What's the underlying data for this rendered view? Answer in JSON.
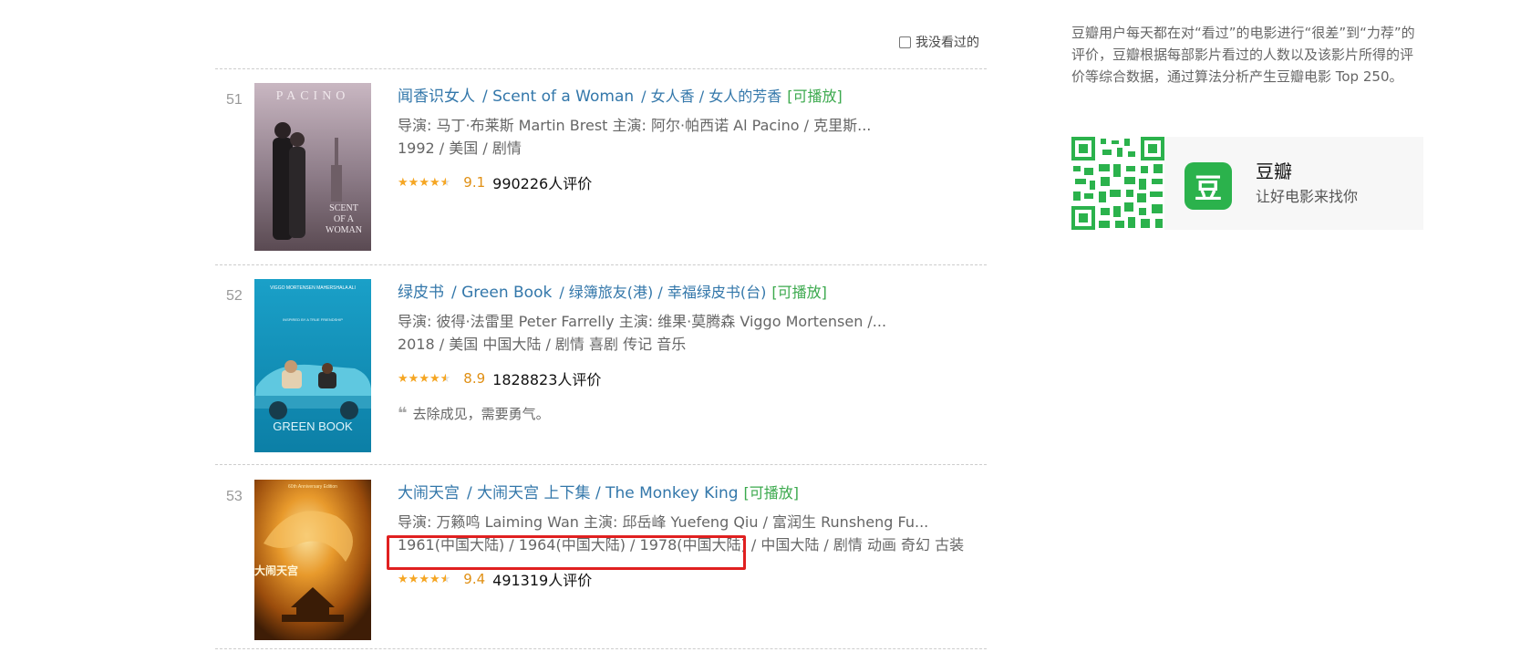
{
  "filter": {
    "label": "我没看过的",
    "checked": false
  },
  "movies": [
    {
      "rank": "51",
      "title": "闻香识女人",
      "other_title": "/ Scent of a Woman",
      "alt_titles": "/ 女人香 / 女人的芳香",
      "playable": "[可播放]",
      "credits": "导演: 马丁·布莱斯 Martin Brest   主演: 阿尔·帕西诺 Al Pacino / 克里斯...",
      "info": "1992 / 美国 / 剧情",
      "stars": 4.5,
      "rating": "9.1",
      "rating_count": "990226人评价",
      "quote": "",
      "poster": {
        "name": "scent-of-a-woman-poster",
        "text_top": "PACINO",
        "text_bottom": "SCENT OF A WOMAN"
      }
    },
    {
      "rank": "52",
      "title": "绿皮书",
      "other_title": "/ Green Book",
      "alt_titles": "/ 绿簿旅友(港) / 幸福绿皮书(台)",
      "playable": "[可播放]",
      "credits": "导演: 彼得·法雷里 Peter Farrelly   主演: 维果·莫腾森 Viggo Mortensen /...",
      "info": "2018 / 美国 中国大陆 / 剧情 喜剧 传记 音乐",
      "stars": 4.5,
      "rating": "8.9",
      "rating_count": "1828823人评价",
      "quote": "去除成见，需要勇气。",
      "poster": {
        "name": "green-book-poster",
        "text_top": "VIGGO MORTENSEN   MAHERSHALA ALI",
        "text_bottom": "GREEN BOOK"
      }
    },
    {
      "rank": "53",
      "title": "大闹天宫",
      "other_title": "/ 大闹天宫 上下集 / The Monkey King",
      "alt_titles": "",
      "playable": "[可播放]",
      "credits": "导演: 万籁鸣 Laiming Wan   主演: 邱岳峰 Yuefeng Qiu / 富润生 Runsheng Fu...",
      "info_highlight": "1961(中国大陆) / 1964(中国大陆) / 1978(中国大陆)",
      "info_rest": " / 中国大陆 / 剧情 动画 奇幻 古装",
      "stars": 4.5,
      "rating": "9.4",
      "rating_count": "491319人评价",
      "quote": "",
      "poster": {
        "name": "monkey-king-poster",
        "text_top": "60th Anniversary Edition",
        "text_bottom": "大闹天宫"
      }
    }
  ],
  "sidebar": {
    "description": "豆瓣用户每天都在对“看过”的电影进行“很差”到“力荐”的评价，豆瓣根据每部影片看过的人数以及该影片所得的评价等综合数据，通过算法分析产生豆瓣电影 Top 250。",
    "app_name": "豆瓣",
    "app_slogan": "让好电影来找你",
    "app_icon_glyph": "豆"
  },
  "colors": {
    "link": "#3377aa",
    "playable": "#3ba94d",
    "star": "#f5a623",
    "rating": "#e09015",
    "highlight": "#e02020",
    "douban_green": "#2bb24c"
  }
}
